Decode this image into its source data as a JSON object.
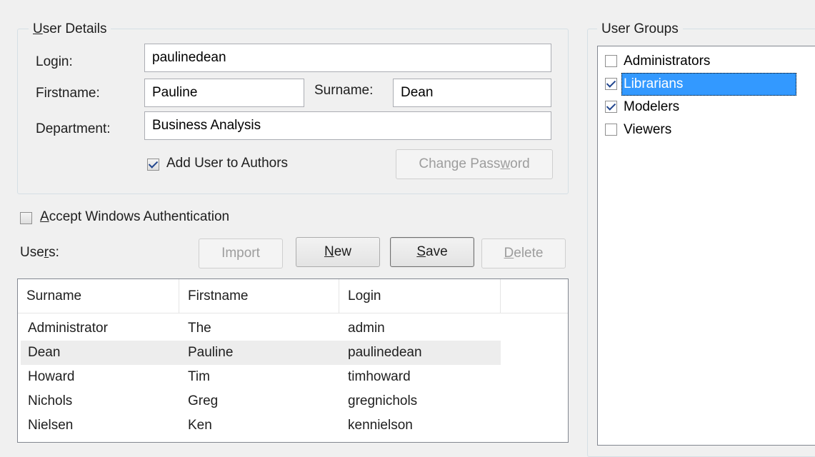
{
  "user_details": {
    "title": "User Details",
    "title_accel": "U",
    "title_rest": "ser Details",
    "login_label": "Login:",
    "login_value": "paulinedean",
    "firstname_label": "Firstname:",
    "firstname_value": "Pauline",
    "surname_label": "Surname:",
    "surname_value": "Dean",
    "department_label": "Department:",
    "department_value": "Business Analysis",
    "add_to_authors_label": "Add User to Authors",
    "add_to_authors_checked": true,
    "change_password_pre": "Change Pass",
    "change_password_accel": "w",
    "change_password_post": "ord"
  },
  "windows_auth": {
    "accel": "A",
    "rest": "ccept Windows Authentication",
    "checked": false
  },
  "users_toolbar": {
    "users_pre": "Use",
    "users_accel": "r",
    "users_post": "s:",
    "import_label": "Import",
    "new_accel": "N",
    "new_rest": "ew",
    "save_accel": "S",
    "save_rest": "ave",
    "delete_accel": "D",
    "delete_rest": "elete"
  },
  "users_table": {
    "columns": [
      "Surname",
      "Firstname",
      "Login"
    ],
    "rows": [
      {
        "surname": "Administrator",
        "firstname": "The",
        "login": "admin"
      },
      {
        "surname": "Dean",
        "firstname": "Pauline",
        "login": "paulinedean",
        "selected": true
      },
      {
        "surname": "Howard",
        "firstname": "Tim",
        "login": "timhoward"
      },
      {
        "surname": "Nichols",
        "firstname": "Greg",
        "login": "gregnichols"
      },
      {
        "surname": "Nielsen",
        "firstname": "Ken",
        "login": "kennielson"
      }
    ]
  },
  "user_groups": {
    "title": "User Groups",
    "items": [
      {
        "label": "Administrators",
        "checked": false
      },
      {
        "label": "Librarians",
        "checked": true,
        "selected": true
      },
      {
        "label": "Modelers",
        "checked": true
      },
      {
        "label": "Viewers",
        "checked": false
      }
    ]
  },
  "colors": {
    "background": "#f0f0f0",
    "selection": "#3399ff",
    "border": "#d5dfe5"
  }
}
